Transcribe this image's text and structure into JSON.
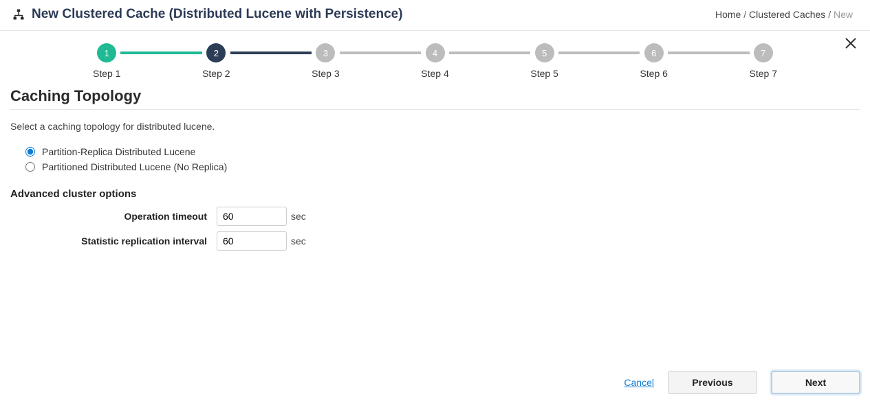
{
  "header": {
    "title": "New Clustered Cache (Distributed Lucene with Persistence)"
  },
  "breadcrumb": {
    "home": "Home",
    "caches": "Clustered Caches",
    "current": "New",
    "sep": "/"
  },
  "stepper": {
    "steps": [
      {
        "num": "1",
        "label": "Step 1",
        "state": "completed"
      },
      {
        "num": "2",
        "label": "Step 2",
        "state": "active"
      },
      {
        "num": "3",
        "label": "Step 3",
        "state": "pending"
      },
      {
        "num": "4",
        "label": "Step 4",
        "state": "pending"
      },
      {
        "num": "5",
        "label": "Step 5",
        "state": "pending"
      },
      {
        "num": "6",
        "label": "Step 6",
        "state": "pending"
      },
      {
        "num": "7",
        "label": "Step 7",
        "state": "pending"
      }
    ]
  },
  "section": {
    "title": "Caching Topology",
    "desc": "Select a caching topology for distributed lucene."
  },
  "radios": {
    "opt1": "Partition-Replica Distributed Lucene",
    "opt2": "Partitioned Distributed Lucene (No Replica)"
  },
  "advanced": {
    "title": "Advanced cluster options",
    "op_timeout_label": "Operation timeout",
    "op_timeout_value": "60",
    "stat_interval_label": "Statistic replication interval",
    "stat_interval_value": "60",
    "unit": "sec"
  },
  "footer": {
    "cancel": "Cancel",
    "previous": "Previous",
    "next": "Next"
  }
}
